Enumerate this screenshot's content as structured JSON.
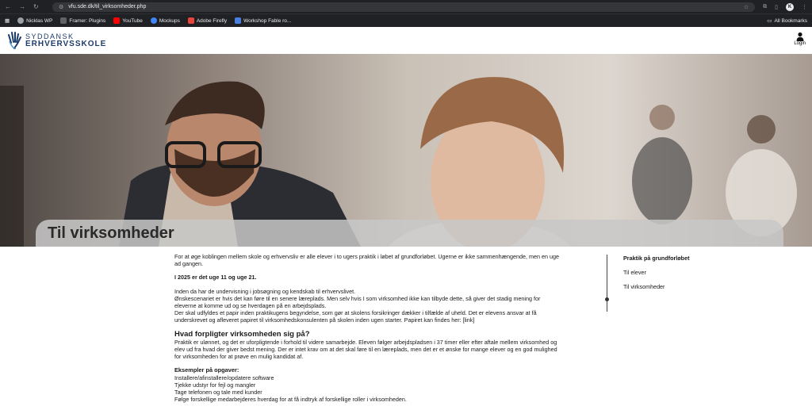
{
  "browser": {
    "url": "vfu.sde.dk/til_virksomheder.php",
    "profile_initial": "K",
    "bookmarks": [
      {
        "label": "Nicklas WP",
        "color": "#9aa0a6"
      },
      {
        "label": "Framer: Plugins",
        "color": "#5f6368"
      },
      {
        "label": "YouTube",
        "color": "#ff0000"
      },
      {
        "label": "Mockups",
        "color": "#4285f4"
      },
      {
        "label": "Adobe Firefly",
        "color": "#e8453c"
      },
      {
        "label": "Workshop Fable ro...",
        "color": "#4a7fe0"
      }
    ],
    "all_bookmarks": "All Bookmarks"
  },
  "header": {
    "logo_line1": "SYDDANSK",
    "logo_line2": "ERHVERVSSKOLE",
    "login_label": "Login"
  },
  "hero": {
    "title": "Til virksomheder"
  },
  "article": {
    "intro": "For at øge koblingen mellem skole og erhvervsliv er alle elever i to ugers praktik i løbet af grundforløbet. Ugerne er ikke sammenhængende, men en uge ad gangen.",
    "weeks": "I 2025 er det uge 11 og uge 21.",
    "para2_l1": "Inden da har de undervisning i jobsøgning og kendskab til erhvervslivet.",
    "para2_l2": "Ønskescenariet er hvis det kan føre til en senere læreplads. Men selv hvis I som virksomhed ikke kan tilbyde dette, så giver det stadig mening for eleverne at komme ud og se hverdagen på en arbejdsplads.",
    "para2_l3": "Der skal udfyldes et papir inden praktikugens begyndelse, som gør at skolens forsikringer dækker i tilfælde af uheld. Det er elevens ansvar at få underskrevet og afleveret papiret til virksomhedskonsulenten på skolen inden ugen starter. Papiret kan findes her: [link]",
    "heading": "Hvad forpligter virksomheden sig på?",
    "para3": "Praktik er ulønnet, og det er uforpligtende i forhold til videre samarbejde. Eleven følger arbejdspladsen i 37 timer eller efter aftale mellem virksomhed og elev ud fra hvad der giver bedst mening. Der er intet krav om at det skal føre til en læreplads, men det er et ønske for mange elever og en god mulighed for virksomheden for at prøve en mulig kandidat af.",
    "examples_heading": "Eksempler på opgaver:",
    "examples": [
      "Installere/afinstallere/opdatere software",
      "Tjekke udstyr for fejl og mangler",
      "Tage telefonen og tale med kunder",
      "Følge forskellige medarbejderes hverdag for at få indtryk af forskellige roller i virksomheden."
    ]
  },
  "sidenav": {
    "items": [
      "Praktik på grundforløbet",
      "Til elever",
      "Til virksomheder"
    ]
  }
}
